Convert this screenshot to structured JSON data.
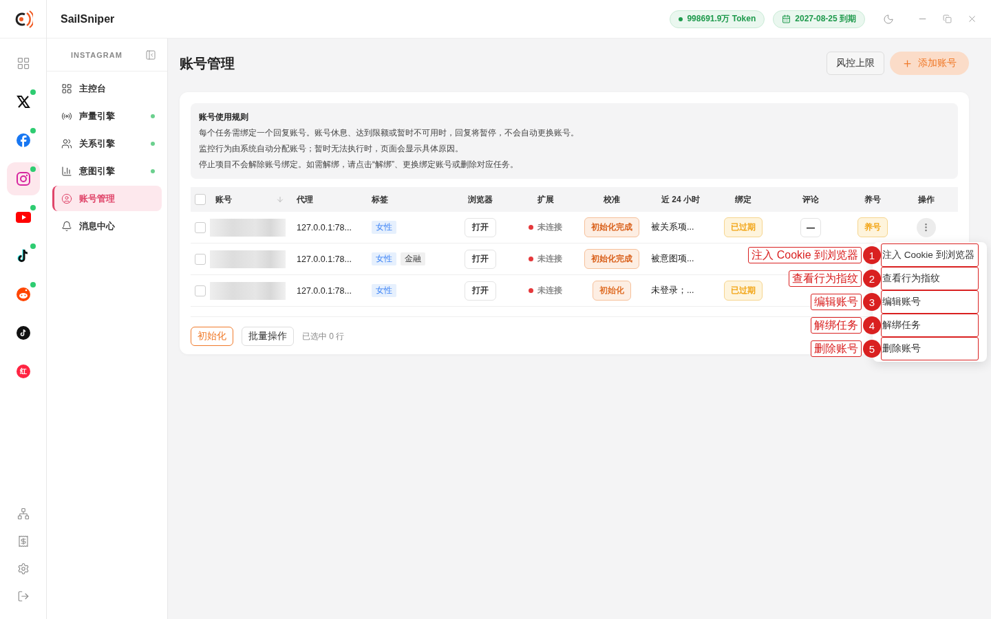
{
  "app": {
    "name": "SailSniper"
  },
  "top_bar": {
    "token": "998691.9万 Token",
    "expiry": "2027-08-25 到期"
  },
  "platforms": [
    {
      "kind": "all",
      "selected": false,
      "online": false
    },
    {
      "kind": "x",
      "selected": false,
      "online": true
    },
    {
      "kind": "facebook",
      "selected": false,
      "online": true
    },
    {
      "kind": "instagram",
      "selected": true,
      "online": true
    },
    {
      "kind": "youtube",
      "selected": false,
      "online": true
    },
    {
      "kind": "tiktok",
      "selected": false,
      "online": true
    },
    {
      "kind": "reddit",
      "selected": false,
      "online": true
    },
    {
      "kind": "tiktok_round",
      "selected": false,
      "online": false
    },
    {
      "kind": "xiaohongshu",
      "text": "红",
      "selected": false,
      "online": false
    }
  ],
  "rail_bottom": [
    {
      "kind": "network"
    },
    {
      "kind": "billing"
    },
    {
      "kind": "settings"
    },
    {
      "kind": "logout"
    }
  ],
  "sidebar": {
    "title": "INSTAGRAM",
    "items": [
      {
        "kind": "dashboard",
        "label": "主控台",
        "selected": false,
        "active": false
      },
      {
        "kind": "volume",
        "label": "声量引擎",
        "selected": false,
        "active": true
      },
      {
        "kind": "relation",
        "label": "关系引擎",
        "selected": false,
        "active": true
      },
      {
        "kind": "intent",
        "label": "意图引擎",
        "selected": false,
        "active": true
      },
      {
        "kind": "accounts",
        "label": "账号管理",
        "selected": true,
        "active": false
      },
      {
        "kind": "messages",
        "label": "消息中心",
        "selected": false,
        "active": false
      }
    ]
  },
  "page": {
    "title": "账号管理",
    "buttons": [
      {
        "kind": "plain",
        "label": "风控上限"
      },
      {
        "kind": "primary",
        "label": "添加账号"
      }
    ]
  },
  "rules": {
    "title": "账号使用规则",
    "lines": [
      "每个任务需绑定一个回复账号。账号休息、达到限额或暂时不可用时，回复将暂停，不会自动更换账号。",
      "监控行为由系统自动分配账号；暂时无法执行时，页面会显示具体原因。",
      "停止项目不会解除账号绑定。如需解绑，请点击“解绑”、更换绑定账号或删除对应任务。"
    ]
  },
  "table": {
    "all_checked": false,
    "columns": [
      "账号",
      "代理",
      "标签",
      "浏览器",
      "扩展",
      "校准",
      "近 24 小时",
      "绑定",
      "评论",
      "养号",
      "操作"
    ],
    "rows": [
      {
        "checked": false,
        "proxy": "127.0.0.1:78...",
        "tags": [
          {
            "kind": "blue",
            "label": "女性"
          }
        ],
        "browser": "打开",
        "extension": {
          "label": "未连接",
          "color": "#e5383b"
        },
        "calibration": {
          "kind": "done",
          "label": "初始化完成"
        },
        "last24": "被关系项...",
        "binding": "已过期",
        "comment": "—",
        "raise": "养号",
        "has_actions": true
      },
      {
        "checked": false,
        "proxy": "127.0.0.1:78...",
        "tags": [
          {
            "kind": "blue",
            "label": "女性"
          },
          {
            "kind": "gray",
            "label": "金融"
          }
        ],
        "browser": "打开",
        "extension": {
          "label": "未连接",
          "color": "#e5383b"
        },
        "calibration": {
          "kind": "done",
          "label": "初始化完成"
        },
        "last24": "被意图项...",
        "has_actions": false
      },
      {
        "checked": false,
        "proxy": "127.0.0.1:78...",
        "tags": [
          {
            "kind": "blue",
            "label": "女性"
          }
        ],
        "browser": "打开",
        "extension": {
          "label": "未连接",
          "color": "#e5383b"
        },
        "calibration": {
          "kind": "init",
          "label": "初始化"
        },
        "last24": "未登录；...",
        "binding": "已过期",
        "has_actions": false
      }
    ]
  },
  "footer": {
    "init_button": "初始化",
    "batch_button": "批量操作",
    "selection": "已选中 0 行"
  },
  "menu": {
    "items": [
      {
        "label": "注入 Cookie 到浏览器",
        "annotation": {
          "number": "1",
          "text": "注入 Cookie 到浏览器"
        }
      },
      {
        "label": "查看行为指纹",
        "annotation": {
          "number": "2",
          "text": "查看行为指纹"
        }
      },
      {
        "label": "编辑账号",
        "annotation": {
          "number": "3",
          "text": "编辑账号"
        }
      },
      {
        "label": "解绑任务",
        "annotation": {
          "number": "4",
          "text": "解绑任务"
        }
      },
      {
        "label": "删除账号",
        "annotation": {
          "number": "5",
          "text": "删除账号"
        }
      }
    ]
  }
}
